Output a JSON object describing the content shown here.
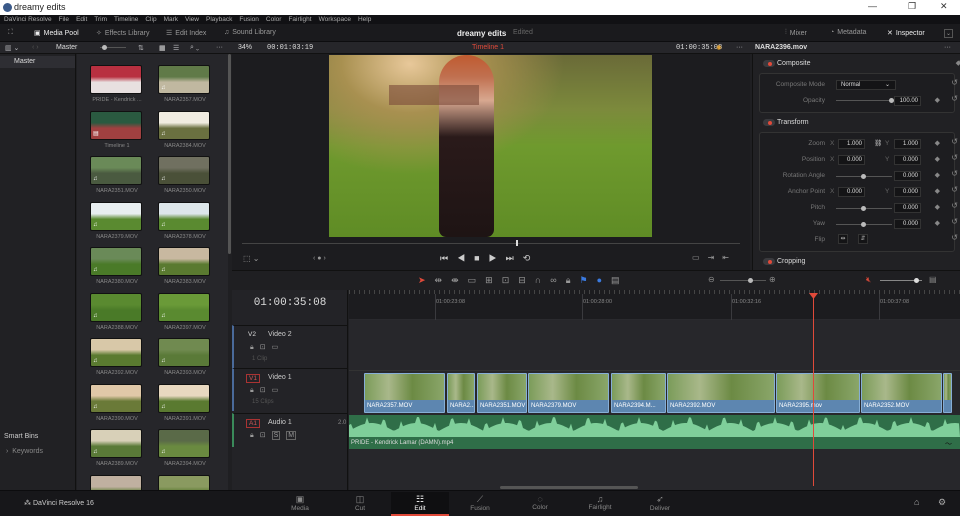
{
  "window": {
    "title": "dreamy edits",
    "minimize": "—",
    "maximize": "❐",
    "close": "✕"
  },
  "menu": [
    "DaVinci Resolve",
    "File",
    "Edit",
    "Trim",
    "Timeline",
    "Clip",
    "Mark",
    "View",
    "Playback",
    "Fusion",
    "Color",
    "Fairlight",
    "Workspace",
    "Help"
  ],
  "toolbar": {
    "media_pool": "Media Pool",
    "effects_library": "Effects Library",
    "edit_index": "Edit Index",
    "sound_library": "Sound Library",
    "project_name": "dreamy edits",
    "project_status": "Edited",
    "mixer": "Mixer",
    "metadata": "Metadata",
    "inspector": "Inspector"
  },
  "subheader": {
    "bin": "Master",
    "zoom": "34%",
    "source_timecode": "00:01:03:19",
    "timeline_name": "Timeline 1",
    "record_timecode": "01:00:35:08",
    "inspector_clip": "NARA2396.mov"
  },
  "sidebar": {
    "master": "Master",
    "smart_bins": "Smart Bins",
    "keywords": "Keywords"
  },
  "media_pool": [
    {
      "name": "PRIDE - Kendrick ...",
      "c1": "#b83040",
      "c2": "#e8e0e0"
    },
    {
      "name": "NARA2357.MOV",
      "c1": "#607a48",
      "c2": "#c0b8a0"
    },
    {
      "name": "Timeline 1",
      "c1": "#2a5a40",
      "c2": "#a04040"
    },
    {
      "name": "NARA2384.MOV",
      "c1": "#f0ece0",
      "c2": "#6a7040"
    },
    {
      "name": "NARA2351.MOV",
      "c1": "#6a8a58",
      "c2": "#4a5a40"
    },
    {
      "name": "NARA2350.MOV",
      "c1": "#707060",
      "c2": "#4a5038"
    },
    {
      "name": "NARA2379.MOV",
      "c1": "#e8eef0",
      "c2": "#5a8a30"
    },
    {
      "name": "NARA2378.MOV",
      "c1": "#dde6ea",
      "c2": "#5a8a30"
    },
    {
      "name": "NARA2380.MOV",
      "c1": "#6a8a58",
      "c2": "#4a7a28"
    },
    {
      "name": "NARA2383.MOV",
      "c1": "#c8b8a0",
      "c2": "#5a7a30"
    },
    {
      "name": "NARA2388.MOV",
      "c1": "#5a8a30",
      "c2": "#4a7a28"
    },
    {
      "name": "NARA2397.MOV",
      "c1": "#6a9a38",
      "c2": "#5a8a30"
    },
    {
      "name": "NARA2392.MOV",
      "c1": "#d8c8a8",
      "c2": "#5a7a30"
    },
    {
      "name": "NARA2393.MOV",
      "c1": "#708a50",
      "c2": "#5a7a38"
    },
    {
      "name": "NARA2390.MOV",
      "c1": "#e0c8a8",
      "c2": "#6a7a38"
    },
    {
      "name": "NARA2391.MOV",
      "c1": "#e8d8c0",
      "c2": "#5a7a30"
    },
    {
      "name": "NARA2389.MOV",
      "c1": "#d8d0b8",
      "c2": "#5a7a38"
    },
    {
      "name": "NARA2394.MOV",
      "c1": "#5a6a48",
      "c2": "#6a8a40"
    },
    {
      "name": "",
      "c1": "#c0b0a0",
      "c2": "#5a7a30"
    },
    {
      "name": "",
      "c1": "#8a9a60",
      "c2": "#5a7a30"
    }
  ],
  "inspector": {
    "composite": {
      "title": "Composite",
      "mode_label": "Composite Mode",
      "mode": "Normal",
      "opacity_label": "Opacity",
      "opacity": "100.00",
      "opacity_value": 100
    },
    "transform": {
      "title": "Transform",
      "zoom_label": "Zoom",
      "zoom_x": "1.000",
      "zoom_y": "1.000",
      "position_label": "Position",
      "position_x": "0.000",
      "position_y": "0.000",
      "rotation_label": "Rotation Angle",
      "rotation": "0.000",
      "anchor_label": "Anchor Point",
      "anchor_x": "0.000",
      "anchor_y": "0.000",
      "pitch_label": "Pitch",
      "pitch": "0.000",
      "yaw_label": "Yaw",
      "yaw": "0.000",
      "flip_label": "Flip",
      "x": "X",
      "y": "Y"
    },
    "cropping": {
      "title": "Cropping"
    }
  },
  "timeline": {
    "timecode": "01:00:35:08",
    "ruler": [
      "01:00:23:08",
      "01:00:28:00",
      "01:00:32:16",
      "01:00:37:08"
    ],
    "tracks": [
      {
        "id": "V2",
        "name": "Video 2",
        "count": "1 Clip"
      },
      {
        "id": "V1",
        "name": "Video 1",
        "count": "15 Clips"
      },
      {
        "id": "A1",
        "name": "Audio 1",
        "channels": "2.0",
        "solo": "S",
        "mute": "M"
      }
    ],
    "clips": [
      "NARA2357.MOV",
      "NARA2...",
      "NARA2351.MOV",
      "NARA2379.MOV",
      "NARA2394.M...",
      "NARA2392.MOV",
      "NARA2395.mov",
      "NARA2352.MOV",
      ""
    ],
    "audio_clip": "PRIDE - Kendrick Lamar (DAMN).mp4"
  },
  "pages": [
    {
      "label": "Media",
      "icon": "▣"
    },
    {
      "label": "Cut",
      "icon": "◫"
    },
    {
      "label": "Edit",
      "icon": "☷"
    },
    {
      "label": "Fusion",
      "icon": "⟋"
    },
    {
      "label": "Color",
      "icon": "◌"
    },
    {
      "label": "Fairlight",
      "icon": "♫"
    },
    {
      "label": "Deliver",
      "icon": "➶"
    }
  ],
  "app": {
    "name": "DaVinci Resolve 16"
  },
  "colors": {
    "accent": "#e04a3a",
    "clip": "#5d86b0",
    "audio": "#7fcf9a"
  }
}
